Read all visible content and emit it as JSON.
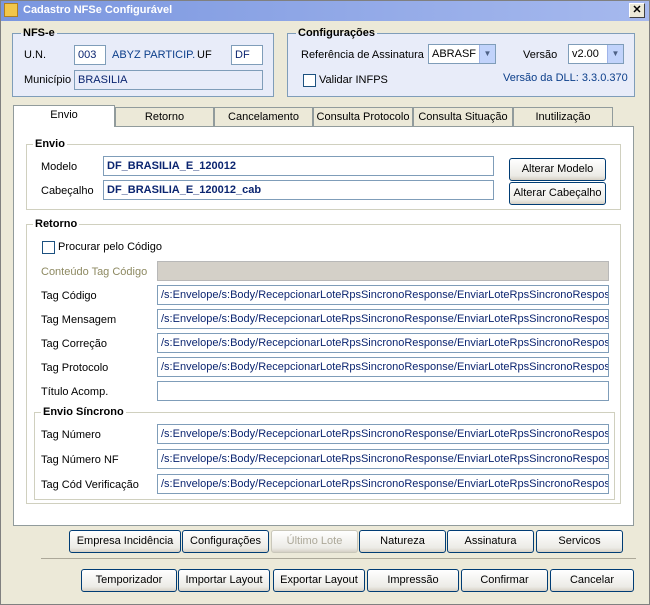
{
  "window": {
    "title": "Cadastro NFSe Configurável",
    "close_symbol": "✕"
  },
  "nfse": {
    "title": "NFS-e",
    "un_label": "U.N.",
    "un_value": "003",
    "company": "ABYZ PARTICIP.",
    "uf_label": "UF",
    "uf_value": "DF",
    "municipio_label": "Município",
    "municipio_value": "BRASILIA"
  },
  "config": {
    "title": "Configurações",
    "ref_label": "Referência de Assinatura",
    "ref_value": "ABRASF",
    "versao_label": "Versão",
    "versao_value": "v2.00",
    "validar_label": "Validar INFPS",
    "dll_version": "Versão da DLL: 3.3.0.370"
  },
  "tabs": [
    "Envio",
    "Retorno",
    "Cancelamento",
    "Consulta Protocolo",
    "Consulta Situação",
    "Inutilização"
  ],
  "envio": {
    "title": "Envio",
    "modelo_label": "Modelo",
    "modelo_value": "DF_BRASILIA_E_120012",
    "alterar_modelo": "Alterar Modelo",
    "cabecalho_label": "Cabeçalho",
    "cabecalho_value": "DF_BRASILIA_E_120012_cab",
    "alterar_cabecalho": "Alterar Cabeçalho"
  },
  "retorno": {
    "title": "Retorno",
    "procurar_label": "Procurar pelo Código",
    "conteudo_label": "Conteúdo Tag Código",
    "tag_codigo_label": "Tag Código",
    "tag_codigo_value": "/s:Envelope/s:Body/RecepcionarLoteRpsSincronoResponse/EnviarLoteRpsSincronoResposta/ListaMensagemRetorno",
    "tag_mensagem_label": "Tag Mensagem",
    "tag_mensagem_value": "/s:Envelope/s:Body/RecepcionarLoteRpsSincronoResponse/EnviarLoteRpsSincronoResposta/ListaMensagemRetorno",
    "tag_correcao_label": "Tag Correção",
    "tag_correcao_value": "/s:Envelope/s:Body/RecepcionarLoteRpsSincronoResponse/EnviarLoteRpsSincronoResposta/ListaMensagemRetorno",
    "tag_protocolo_label": "Tag Protocolo",
    "tag_protocolo_value": "/s:Envelope/s:Body/RecepcionarLoteRpsSincronoResponse/EnviarLoteRpsSincronoResposta/Protocolo",
    "titulo_label": "Título Acomp.",
    "titulo_value": ""
  },
  "sincrono": {
    "title": "Envio Síncrono",
    "tag_numero_label": "Tag Número",
    "tag_numero_value": "/s:Envelope/s:Body/RecepcionarLoteRpsSincronoResponse/EnviarLoteRpsSincronoResposta/ListaNfse",
    "tag_numero_nf_label": "Tag Número NF",
    "tag_numero_nf_value": "/s:Envelope/s:Body/RecepcionarLoteRpsSincronoResponse/EnviarLoteRpsSincronoResposta/ListaNfse",
    "tag_cod_label": "Tag Cód Verificação",
    "tag_cod_value": "/s:Envelope/s:Body/RecepcionarLoteRpsSincronoResponse/EnviarLoteRpsSincronoResposta/ListaNfse"
  },
  "buttons_row1": {
    "empresa": "Empresa Incidência",
    "configuracoes": "Configurações",
    "ultimo_lote": "Último Lote",
    "natureza": "Natureza",
    "assinatura": "Assinatura",
    "servicos": "Servicos"
  },
  "buttons_row2": {
    "temporizador": "Temporizador",
    "importar": "Importar Layout",
    "exportar": "Exportar Layout",
    "impressao": "Impressão",
    "confirmar": "Confirmar",
    "cancelar": "Cancelar"
  }
}
